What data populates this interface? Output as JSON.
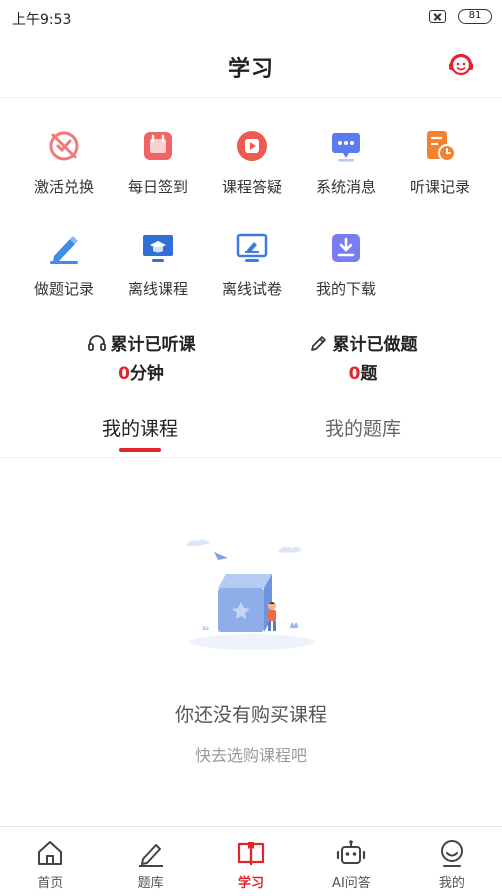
{
  "status_bar": {
    "time": "上午9:53",
    "battery": "81"
  },
  "header": {
    "title": "学习"
  },
  "grid": [
    {
      "label": "激活兑换",
      "icon": "activate-redeem-icon",
      "color": "#f07a7a"
    },
    {
      "label": "每日签到",
      "icon": "daily-checkin-icon",
      "color": "#f06464"
    },
    {
      "label": "课程答疑",
      "icon": "course-qa-icon",
      "color": "#ef5a50"
    },
    {
      "label": "系统消息",
      "icon": "system-message-icon",
      "color": "#5b7cf0"
    },
    {
      "label": "听课记录",
      "icon": "listen-record-icon",
      "color": "#f3822e"
    },
    {
      "label": "做题记录",
      "icon": "exercise-record-icon",
      "color": "#3f8de8"
    },
    {
      "label": "离线课程",
      "icon": "offline-course-icon",
      "color": "#2f6fd6"
    },
    {
      "label": "离线试卷",
      "icon": "offline-paper-icon",
      "color": "#3c7ee0"
    },
    {
      "label": "我的下载",
      "icon": "my-download-icon",
      "color": "#7a7cf2"
    }
  ],
  "stats": {
    "listen": {
      "title": "累计已听课",
      "value": "0",
      "unit": "分钟"
    },
    "exercise": {
      "title": "累计已做题",
      "value": "0",
      "unit": "题"
    }
  },
  "tabs": [
    {
      "label": "我的课程",
      "active": true
    },
    {
      "label": "我的题库",
      "active": false
    }
  ],
  "empty": {
    "title": "你还没有购买课程",
    "subtitle": "快去选购课程吧"
  },
  "nav": [
    {
      "label": "首页",
      "icon": "home-icon"
    },
    {
      "label": "题库",
      "icon": "question-bank-icon"
    },
    {
      "label": "学习",
      "icon": "study-book-icon",
      "active": true
    },
    {
      "label": "AI问答",
      "icon": "ai-robot-icon"
    },
    {
      "label": "我的",
      "icon": "profile-icon"
    }
  ],
  "colors": {
    "accent": "#e3252b"
  }
}
